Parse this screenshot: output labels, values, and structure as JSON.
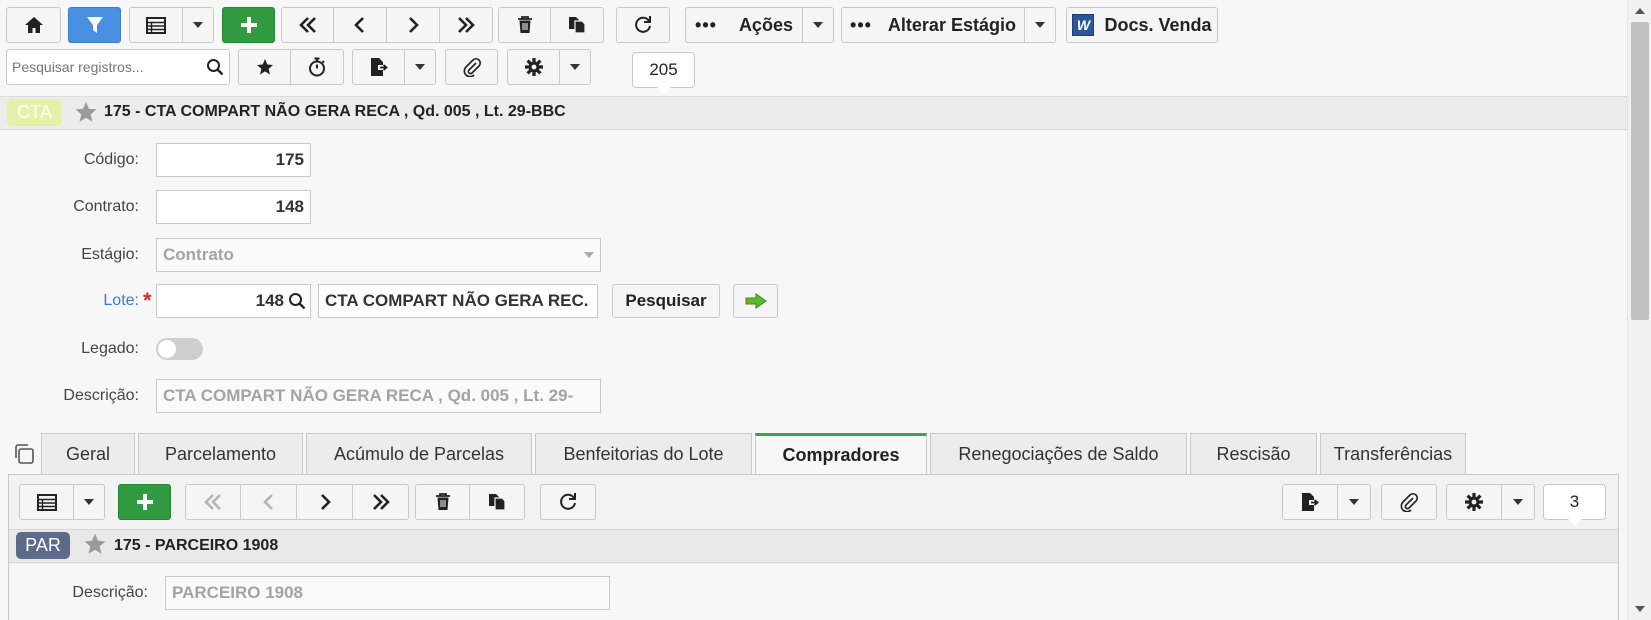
{
  "toolbar": {
    "acoes_label": "Ações",
    "alterar_estagio_label": "Alterar Estágio",
    "docs_venda_label": "Docs. Venda",
    "search_placeholder": "Pesquisar registros...",
    "record_count": "205"
  },
  "header": {
    "badge": "CTA",
    "title": "175 - CTA COMPART NÃO GERA RECA , Qd. 005 , Lt. 29-BBC"
  },
  "form": {
    "codigo_label": "Código:",
    "codigo_value": "175",
    "contrato_label": "Contrato:",
    "contrato_value": "148",
    "estagio_label": "Estágio:",
    "estagio_value": "Contrato",
    "lote_label": "Lote:",
    "lote_required": "*",
    "lote_value": "148",
    "lote_desc": "CTA COMPART NÃO GERA REC.",
    "pesquisar_label": "Pesquisar",
    "legado_label": "Legado:",
    "descricao_label": "Descrição:",
    "descricao_value": "CTA COMPART NÃO GERA RECA ,  Qd. 005 ,  Lt. 29-"
  },
  "tabs": [
    {
      "label": "Geral"
    },
    {
      "label": "Parcelamento"
    },
    {
      "label": "Acúmulo de Parcelas"
    },
    {
      "label": "Benfeitorias do Lote"
    },
    {
      "label": "Compradores"
    },
    {
      "label": "Renegociações de Saldo"
    },
    {
      "label": "Rescisão"
    },
    {
      "label": "Transferências"
    }
  ],
  "active_tab": "Compradores",
  "sub": {
    "record_count": "3",
    "badge": "PAR",
    "title": "175 - PARCEIRO 1908",
    "descricao_label": "Descrição:",
    "descricao_value": "PARCEIRO 1908"
  },
  "colors": {
    "accent_green": "#2f9a3f",
    "filter_blue": "#4a90e2",
    "cta_badge": "#e4f1a6",
    "par_badge": "#5c6b8a",
    "active_tab_border": "#3aa34a",
    "link_blue": "#3a7bd5"
  }
}
